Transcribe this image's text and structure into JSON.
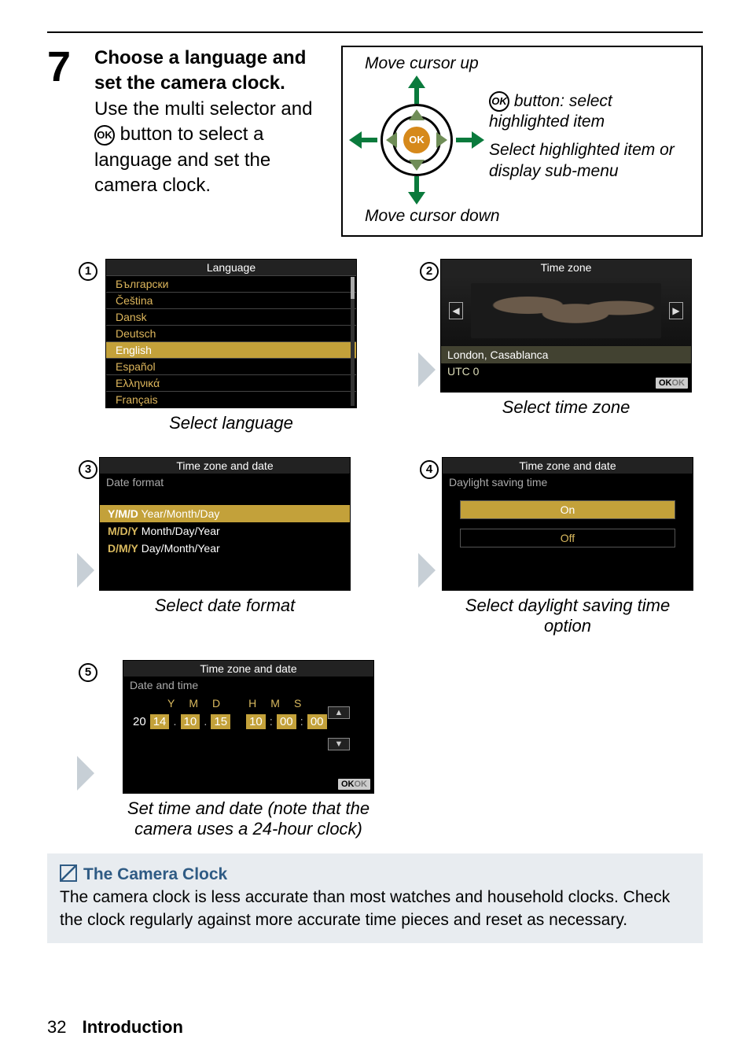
{
  "step": {
    "number": "7",
    "title": "Choose a language and set the camera clock.",
    "body_a": "Use the multi selector and ",
    "ok_small": "OK",
    "body_b": " button to select a language and set the camera clock."
  },
  "selector": {
    "up": "Move cursor up",
    "down": "Move cursor down",
    "ok_label": "OK",
    "ok_button_text_a": " button: select highlighted item",
    "sub_text": "Select highlighted item or display sub-menu"
  },
  "circ": {
    "n1": "1",
    "n2": "2",
    "n3": "3",
    "n4": "4",
    "n5": "5"
  },
  "lang": {
    "title": "Language",
    "items": [
      "Български",
      "Čeština",
      "Dansk",
      "Deutsch",
      "English",
      "Español",
      "Ελληνικά",
      "Français"
    ],
    "caption": "Select language"
  },
  "tz": {
    "title": "Time zone",
    "zone": "London, Casablanca",
    "utc": "UTC  0",
    "ok": "OK",
    "okgray": "OK",
    "caption": "Select time zone",
    "left": "◀",
    "right": "▶"
  },
  "df": {
    "title": "Time zone and date",
    "sub": "Date format",
    "opts": [
      {
        "tag": "Y/M/D",
        "label": " Year/Month/Day"
      },
      {
        "tag": "M/D/Y",
        "label": " Month/Day/Year"
      },
      {
        "tag": "D/M/Y",
        "label": " Day/Month/Year"
      }
    ],
    "caption": "Select date format"
  },
  "dst": {
    "title": "Time zone and date",
    "sub": "Daylight saving time",
    "on": "On",
    "off": "Off",
    "caption": "Select daylight saving time option"
  },
  "dt": {
    "title": "Time zone and date",
    "sub": "Date and time",
    "cols": [
      "Y",
      "M",
      "D",
      "H",
      "M",
      "S"
    ],
    "prefix20": "20",
    "y": "14",
    "dot": ".",
    "m": "10",
    "d": "15",
    "h": "10",
    "colon": ":",
    "mi": "00",
    "s": "00",
    "ok": "OK",
    "okgray": "OK",
    "up": "▲",
    "down": "▼",
    "caption": "Set time and date (note that the camera uses a 24-hour clock)"
  },
  "note": {
    "title": "The Camera Clock",
    "body": "The camera clock is less accurate than most watches and household clocks.  Check the clock regularly against more accurate time pieces and reset as necessary."
  },
  "footer": {
    "page": "32",
    "section": "Introduction"
  }
}
